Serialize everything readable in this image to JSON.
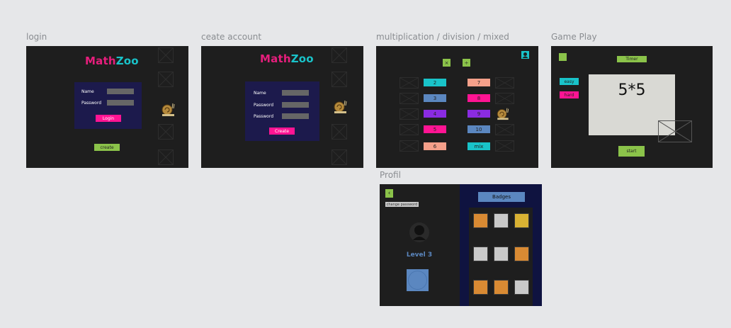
{
  "frames": {
    "login": {
      "label": "login",
      "logo": {
        "segments": [
          "Math",
          "Zoo"
        ],
        "colors": [
          "#e61e7c",
          "#19c3c9"
        ]
      },
      "name_label": "Name",
      "password_label": "Password",
      "login_button": "Login",
      "create_button": "create"
    },
    "create_account": {
      "label": "ceate account",
      "logo": {
        "segments": [
          "Math",
          "Zoo"
        ],
        "colors": [
          "#e61e7c",
          "#19c3c9"
        ]
      },
      "name_label": "Name",
      "password_label": "Password",
      "password_label_2": "Password",
      "create_button": "Create"
    },
    "operations": {
      "label": "multiplication / division / mixed",
      "op_multiply": "×",
      "op_divide": "÷",
      "numbers_left": [
        {
          "value": "2",
          "color": "#19c3c9"
        },
        {
          "value": "3",
          "color": "#5b87c0"
        },
        {
          "value": "4",
          "color": "#8a2be2"
        },
        {
          "value": "5",
          "color": "#ff1493"
        },
        {
          "value": "6",
          "color": "#f4a08a"
        }
      ],
      "numbers_right": [
        {
          "value": "7",
          "color": "#f4a08a"
        },
        {
          "value": "8",
          "color": "#ff1493"
        },
        {
          "value": "9",
          "color": "#8a2be2"
        },
        {
          "value": "10",
          "color": "#5b87c0"
        },
        {
          "value": "mix",
          "color": "#19c3c9"
        }
      ]
    },
    "gameplay": {
      "label": "Game Play",
      "timer_label": "Timer",
      "easy_label": "easy",
      "hard_label": "hard",
      "question": "5*5",
      "start_button": "start"
    },
    "profile": {
      "label": "Profil",
      "back_icon": "‹",
      "change_password": "change password",
      "level_text": "Level 3",
      "badges_title": "Badges",
      "badge_colors": [
        "#d98a33",
        "#c9c9c9",
        "#d9b233",
        "#c9c9c9",
        "#c9c9c9",
        "#d98a33",
        "#d98a33",
        "#d98a33",
        "#c9c9c9"
      ]
    }
  },
  "colors": {
    "accent_green": "#8bc34a",
    "accent_pink": "#ff1493",
    "accent_cyan": "#19c3c9",
    "panel_navy": "#1c1a4c"
  }
}
